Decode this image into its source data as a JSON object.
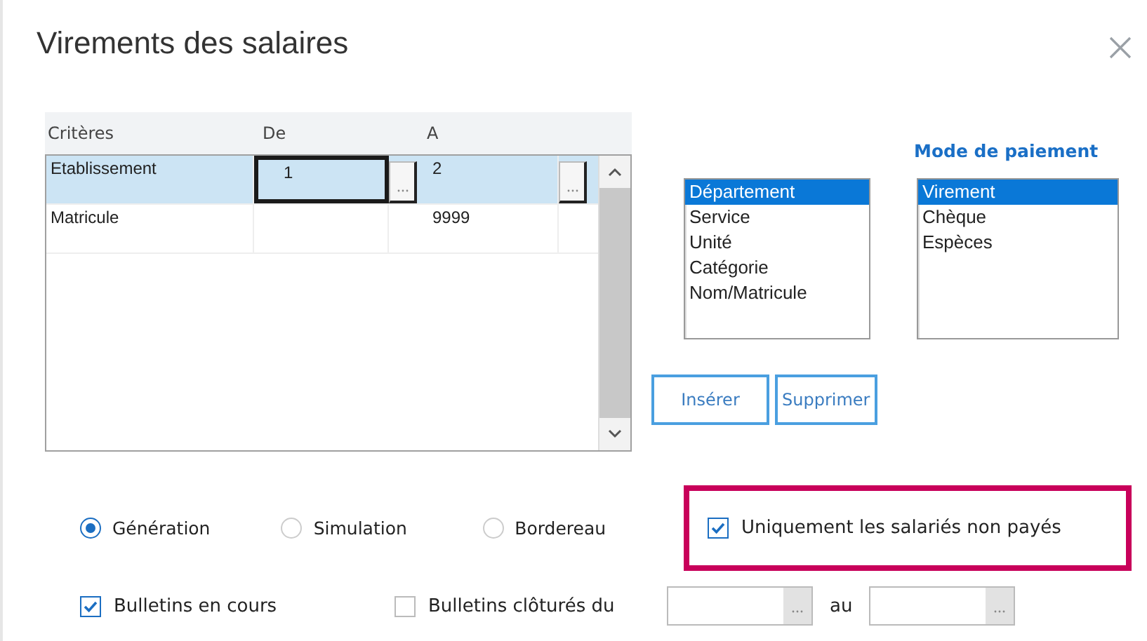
{
  "window": {
    "title": "Virements des salaires"
  },
  "criteria_table": {
    "columns": [
      "Critères",
      "De",
      "A"
    ],
    "rows": [
      {
        "criterion": "Etablissement",
        "from": "1",
        "to": "2",
        "selected": true
      },
      {
        "criterion": "Matricule",
        "to": "9999",
        "selected": false
      }
    ]
  },
  "sort_list": {
    "items": [
      {
        "label": "Département",
        "selected": true
      },
      {
        "label": "Service",
        "selected": false
      },
      {
        "label": "Unité",
        "selected": false
      },
      {
        "label": "Catégorie",
        "selected": false
      },
      {
        "label": "Nom/Matricule",
        "selected": false
      }
    ]
  },
  "payment_mode": {
    "label": "Mode de paiement",
    "items": [
      {
        "label": "Virement",
        "selected": true
      },
      {
        "label": "Chèque",
        "selected": false
      },
      {
        "label": "Espèces",
        "selected": false
      }
    ]
  },
  "buttons": [
    "Insérer",
    "Supprimer"
  ],
  "modes": [
    {
      "label": "Génération",
      "selected": true
    },
    {
      "label": "Simulation",
      "selected": false
    },
    {
      "label": "Bordereau",
      "selected": false
    }
  ],
  "only_unpaid": {
    "label": "Uniquement les salariés non payés",
    "checked": true,
    "highlighted": true
  },
  "current_payslips": {
    "label": "Bulletins en cours",
    "checked": true
  },
  "closed_payslips": {
    "label": "Bulletins clôturés du",
    "checked": false,
    "to_label": "au"
  }
}
